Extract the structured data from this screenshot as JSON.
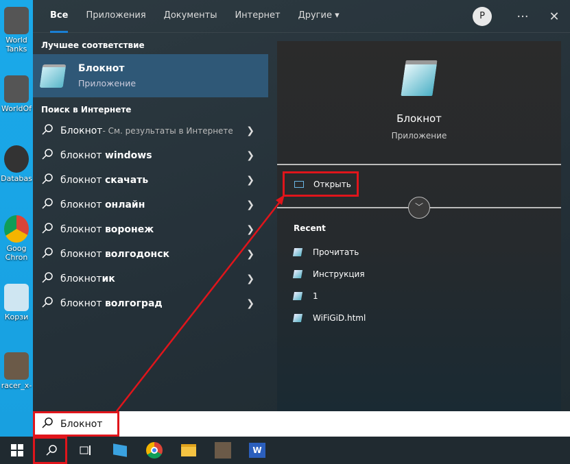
{
  "desktop": {
    "icons": [
      [
        "World",
        "Tanks"
      ],
      [
        "WorldOf"
      ],
      [
        "Databas"
      ],
      [
        "Goog",
        "Chron"
      ],
      [
        "Корзи"
      ],
      [
        "racer_x-"
      ]
    ]
  },
  "tabs": [
    "Все",
    "Приложения",
    "Документы",
    "Интернет",
    "Другие ▾"
  ],
  "header": {
    "avatar": "P",
    "more": "···",
    "close": "✕"
  },
  "left": {
    "best_match_heading": "Лучшее соответствие",
    "best_match": {
      "title": "Блокнот",
      "subtitle": "Приложение"
    },
    "web_heading": "Поиск в Интернете",
    "web_first": {
      "bold": "Блокнот",
      "rest": " - См. результаты в Интернете"
    },
    "web_items": [
      [
        "блокнот ",
        "windows"
      ],
      [
        "блокнот ",
        "скачать"
      ],
      [
        "блокнот ",
        "онлайн"
      ],
      [
        "блокнот ",
        "воронеж"
      ],
      [
        "блокнот ",
        "волгодонск"
      ],
      [
        "блокнот",
        "ик"
      ],
      [
        "блокнот ",
        "волгоград"
      ]
    ]
  },
  "preview": {
    "title": "Блокнот",
    "subtitle": "Приложение",
    "open": "Открыть",
    "recent_heading": "Recent",
    "recent": [
      "Прочитать",
      "Инструкция",
      "1",
      "WiFiGiD.html"
    ]
  },
  "search": {
    "value": "Блокнот"
  },
  "colors": {
    "accent": "#1a7fd4",
    "highlight": "#e0151b",
    "selected": "#2f5877"
  }
}
